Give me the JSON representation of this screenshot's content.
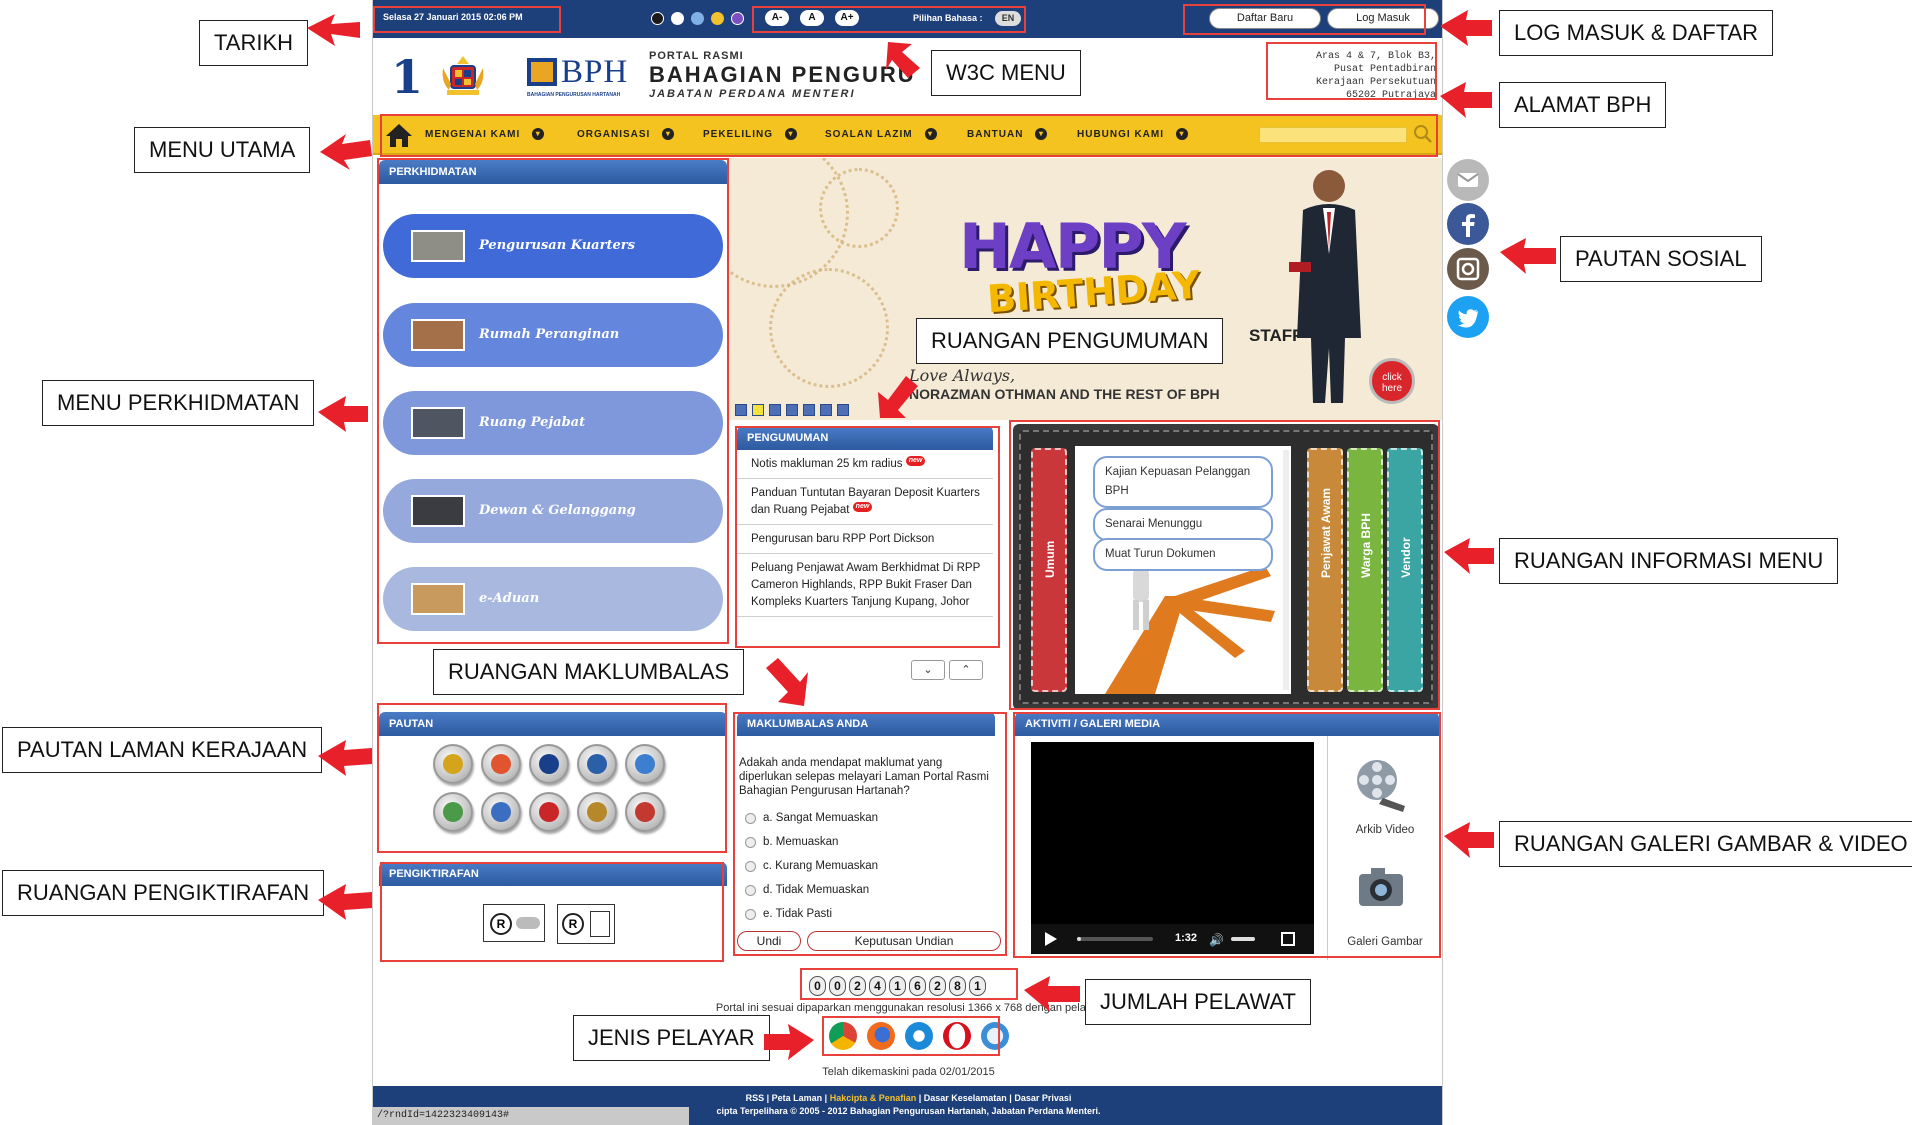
{
  "topbar": {
    "date": "Selasa 27 Januari 2015 02:06 PM",
    "font_buttons": [
      "A-",
      "A",
      "A+"
    ],
    "language_label": "Pilihan Bahasa :",
    "language_value": "EN",
    "register_label": "Daftar Baru",
    "login_label": "Log Masuk",
    "theme_colors": [
      "#1a1a1a",
      "#ffffff",
      "#7fb1e6",
      "#f2c12e",
      "#7b4fc2"
    ]
  },
  "header": {
    "logo_number": "1",
    "bph_logo": "BPH",
    "bph_logo_sub": "BAHAGIAN PENGURUSAN HARTANAH",
    "portal_label": "PORTAL RASMI",
    "portal_title": "BAHAGIAN PENGURU",
    "portal_title_tail": "H",
    "department": "JABATAN PERDANA MENTERI",
    "address": [
      "Aras 4 & 7, Blok B3,",
      "Pusat Pentadbiran",
      "Kerajaan Persekutuan",
      "65202 Putrajaya"
    ]
  },
  "nav": {
    "items": [
      {
        "label": "MENGENAI KAMI"
      },
      {
        "label": "ORGANISASI"
      },
      {
        "label": "PEKELILING"
      },
      {
        "label": "SOALAN LAZIM"
      },
      {
        "label": "BANTUAN"
      },
      {
        "label": "HUBUNGI KAMI"
      }
    ]
  },
  "services": {
    "title": "PERKHIDMATAN",
    "items": [
      {
        "label": "Pengurusan Kuarters",
        "color": "#3f6ad8"
      },
      {
        "label": "Rumah Peranginan",
        "color": "#6486dc"
      },
      {
        "label": "Ruang Pejabat",
        "color": "#7f98dc"
      },
      {
        "label": "Dewan & Gelanggang",
        "color": "#95a9dd"
      },
      {
        "label": "e-Aduan",
        "color": "#a9b8df"
      }
    ]
  },
  "banner": {
    "happy": "HAPPY",
    "birthday": "BIRTHDAY",
    "staff_text": "STAFF",
    "love": "Love Always,",
    "names": "NORAZMAN OTHMAN AND THE REST OF BPH",
    "click_here": "click here"
  },
  "announcements": {
    "title": "PENGUMUMAN",
    "items": [
      {
        "text": "Notis makluman 25 km radius",
        "new": "new"
      },
      {
        "text": "Panduan Tuntutan Bayaran Deposit Kuarters dan Ruang Pejabat",
        "new": "new"
      },
      {
        "text": "Pengurusan baru RPP Port Dickson",
        "new": ""
      },
      {
        "text": "Peluang Penjawat Awam Berkhidmat Di RPP Cameron Highlands, RPP Bukit Fraser Dan Kompleks Kuarters Tanjung Kupang, Johor",
        "new": ""
      }
    ]
  },
  "info_menu": {
    "tabs": [
      {
        "label": "Umum",
        "color": "#c9373a"
      },
      {
        "label": "Penjawat Awam",
        "color": "#c9893a"
      },
      {
        "label": "Warga BPH",
        "color": "#7ab540"
      },
      {
        "label": "Vendor",
        "color": "#3aa5a3"
      }
    ],
    "links": [
      "Kajian Kepuasan Pelanggan BPH",
      "Senarai Menunggu",
      "Muat Turun Dokumen"
    ]
  },
  "links_panel": {
    "title": "PAUTAN",
    "coin_colors": [
      "#d4a51c",
      "#e0552f",
      "#1a3f8a",
      "#2b5fa8",
      "#3c7fd1",
      "#4a9a4a",
      "#3b6ec0",
      "#c9262a",
      "#b5892a",
      "#c23a2f"
    ]
  },
  "recognition": {
    "title": "PENGIKTIRAFAN"
  },
  "survey": {
    "title": "MAKLUMBALAS ANDA",
    "question": "Adakah anda mendapat maklumat yang diperlukan selepas melayari Laman Portal Rasmi Bahagian Pengurusan Hartanah?",
    "options": [
      "a. Sangat Memuaskan",
      "b. Memuaskan",
      "c. Kurang Memuaskan",
      "d. Tidak Memuaskan",
      "e. Tidak Pasti"
    ],
    "vote_label": "Undi",
    "results_label": "Keputusan Undian"
  },
  "media": {
    "title": "AKTIVITI / GALERI MEDIA",
    "video_time": "1:32",
    "video_archive": "Arkib Video",
    "photo_gallery": "Galeri Gambar",
    "video_progress": 0.05
  },
  "visitors": {
    "digits": [
      "0",
      "0",
      "2",
      "4",
      "1",
      "6",
      "2",
      "8",
      "1"
    ]
  },
  "resolution_note": "Portal ini sesuai dipaparkan menggunakan resolusi 1366 x 768 dengan pelayar",
  "browsers": [
    "chrome-icon",
    "firefox-icon",
    "ie-icon",
    "opera-icon",
    "safari-icon"
  ],
  "updated": "Telah dikemaskini pada 02/01/2015",
  "footer": {
    "line1_a": "RSS | Peta Laman | ",
    "line1_b": "Hakcipta & Penafian",
    "line1_c": " | Dasar Keselamatan | Dasar Privasi",
    "line2": "cipta Terpelihara © 2005 - 2012 Bahagian Pengurusan Hartanah, Jabatan Perdana Menteri."
  },
  "status_url": "/?rndId=1422323409143#",
  "social": [
    {
      "name": "email-icon",
      "color": "#b9b9b9"
    },
    {
      "name": "facebook-icon",
      "color": "#3b5998"
    },
    {
      "name": "instagram-icon",
      "color": "#6b5a4a"
    },
    {
      "name": "twitter-icon",
      "color": "#1da1f2"
    }
  ],
  "callouts": {
    "tarikh": "TARIKH",
    "w3c": "W3C MENU",
    "login": "LOG MASUK & DAFTAR",
    "alamat": "ALAMAT BPH",
    "menu_utama": "MENU UTAMA",
    "pautan_sosial": "PAUTAN SOSIAL",
    "ruangan_pengumuman": "RUANGAN PENGUMUMAN",
    "menu_perkhidmatan": "MENU PERKHIDMATAN",
    "ruangan_informasi": "RUANGAN INFORMASI MENU",
    "ruangan_maklumbalas": "RUANGAN MAKLUMBALAS",
    "pautan_laman": "PAUTAN LAMAN KERAJAAN",
    "ruangan_galeri": "RUANGAN GALERI GAMBAR & VIDEO",
    "ruangan_pengiktirafan": "RUANGAN PENGIKTIRAFAN",
    "jumlah_pelawat": "JUMLAH PELAWAT",
    "jenis_pelayar": "JENIS PELAYAR"
  }
}
